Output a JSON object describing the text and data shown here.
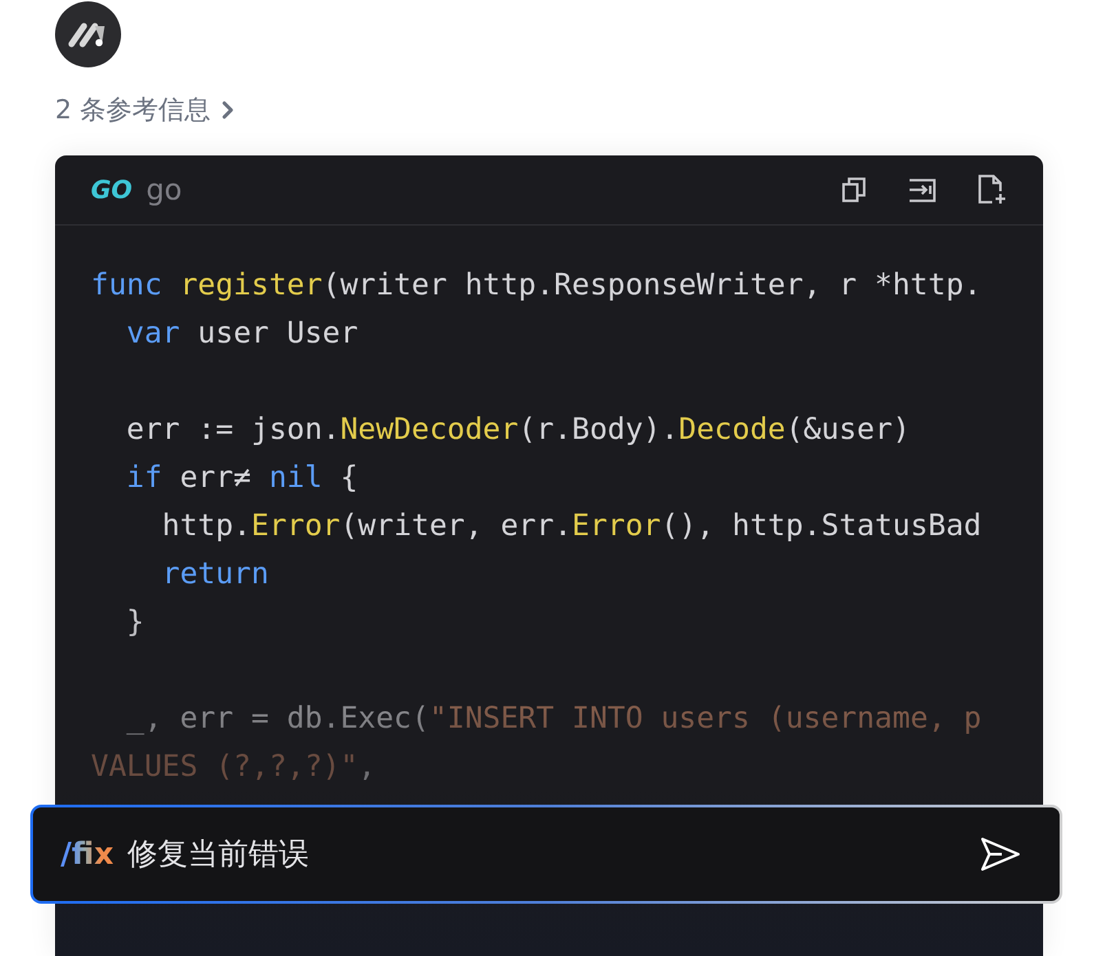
{
  "references": {
    "label": "2 条参考信息"
  },
  "code_block": {
    "logo": "GO",
    "language": "go",
    "lines": [
      {
        "kind": "code",
        "tokens": [
          {
            "kind": "keyword",
            "text": "func"
          },
          {
            "kind": "function",
            "text": " register"
          },
          {
            "kind": "plain",
            "text": "(writer http.ResponseWriter, r *http."
          }
        ]
      },
      {
        "kind": "code",
        "tokens": [
          {
            "kind": "keyword",
            "text": "  var"
          },
          {
            "kind": "plain",
            "text": " user User"
          }
        ]
      },
      {
        "kind": "blank"
      },
      {
        "kind": "code",
        "tokens": [
          {
            "kind": "plain",
            "text": "  err := json."
          },
          {
            "kind": "function",
            "text": "NewDecoder"
          },
          {
            "kind": "plain",
            "text": "(r.Body)."
          },
          {
            "kind": "function",
            "text": "Decode"
          },
          {
            "kind": "plain",
            "text": "(&user)"
          }
        ]
      },
      {
        "kind": "code",
        "tokens": [
          {
            "kind": "keyword",
            "text": "  if"
          },
          {
            "kind": "plain",
            "text": " err≠ "
          },
          {
            "kind": "keyword",
            "text": "nil"
          },
          {
            "kind": "plain",
            "text": " {"
          }
        ]
      },
      {
        "kind": "code",
        "tokens": [
          {
            "kind": "plain",
            "text": "    http."
          },
          {
            "kind": "function",
            "text": "Error"
          },
          {
            "kind": "plain",
            "text": "(writer, err."
          },
          {
            "kind": "function",
            "text": "Error"
          },
          {
            "kind": "plain",
            "text": "(), http.StatusBad"
          }
        ]
      },
      {
        "kind": "code",
        "tokens": [
          {
            "kind": "keyword",
            "text": "    return"
          }
        ]
      },
      {
        "kind": "code",
        "tokens": [
          {
            "kind": "plain",
            "text": "  }"
          }
        ]
      },
      {
        "kind": "blank"
      },
      {
        "kind": "code",
        "tokens": [
          {
            "kind": "plain",
            "text": "  _, err = db.Exec("
          },
          {
            "kind": "string",
            "text": "\"INSERT INTO users (username, p"
          }
        ]
      },
      {
        "kind": "code",
        "tokens": [
          {
            "kind": "string",
            "text": "VALUES (?,?,?)\""
          },
          {
            "kind": "plain",
            "text": ","
          }
        ]
      }
    ]
  },
  "prompt": {
    "command": "/fix",
    "text": "修复当前错误"
  }
}
